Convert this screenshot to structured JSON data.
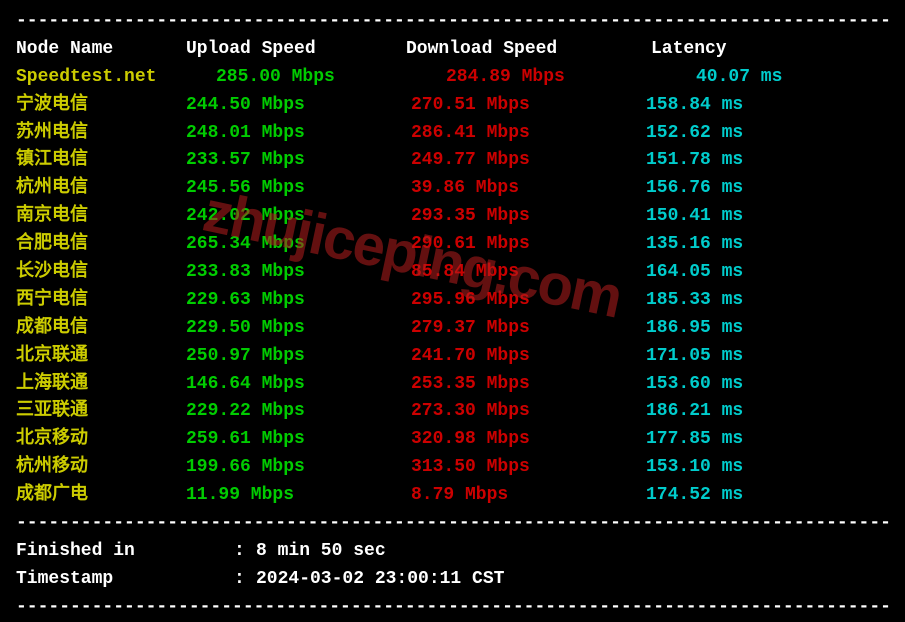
{
  "divider": "----------------------------------------------------------------------------------",
  "headers": {
    "node": "Node Name",
    "upload": "Upload Speed",
    "download": "Download Speed",
    "latency": "Latency"
  },
  "speedtest": {
    "name": "Speedtest.net",
    "upload": "285.00 Mbps",
    "download": "284.89 Mbps",
    "latency": "40.07 ms"
  },
  "rows": [
    {
      "node": "宁波电信",
      "upload": "244.50 Mbps",
      "download": "270.51 Mbps",
      "latency": "158.84 ms"
    },
    {
      "node": "苏州电信",
      "upload": "248.01 Mbps",
      "download": "286.41 Mbps",
      "latency": "152.62 ms"
    },
    {
      "node": "镇江电信",
      "upload": "233.57 Mbps",
      "download": "249.77 Mbps",
      "latency": "151.78 ms"
    },
    {
      "node": "杭州电信",
      "upload": "245.56 Mbps",
      "download": "39.86 Mbps",
      "latency": "156.76 ms"
    },
    {
      "node": "南京电信",
      "upload": "242.02 Mbps",
      "download": "293.35 Mbps",
      "latency": "150.41 ms"
    },
    {
      "node": "合肥电信",
      "upload": "265.34 Mbps",
      "download": "290.61 Mbps",
      "latency": "135.16 ms"
    },
    {
      "node": "长沙电信",
      "upload": "233.83 Mbps",
      "download": "85.84 Mbps",
      "latency": "164.05 ms"
    },
    {
      "node": "西宁电信",
      "upload": "229.63 Mbps",
      "download": "295.96 Mbps",
      "latency": "185.33 ms"
    },
    {
      "node": "成都电信",
      "upload": "229.50 Mbps",
      "download": "279.37 Mbps",
      "latency": "186.95 ms"
    },
    {
      "node": "北京联通",
      "upload": "250.97 Mbps",
      "download": "241.70 Mbps",
      "latency": "171.05 ms"
    },
    {
      "node": "上海联通",
      "upload": "146.64 Mbps",
      "download": "253.35 Mbps",
      "latency": "153.60 ms"
    },
    {
      "node": "三亚联通",
      "upload": "229.22 Mbps",
      "download": "273.30 Mbps",
      "latency": "186.21 ms"
    },
    {
      "node": "北京移动",
      "upload": "259.61 Mbps",
      "download": "320.98 Mbps",
      "latency": "177.85 ms"
    },
    {
      "node": "杭州移动",
      "upload": "199.66 Mbps",
      "download": "313.50 Mbps",
      "latency": "153.10 ms"
    },
    {
      "node": "成都广电",
      "upload": "11.99 Mbps",
      "download": "8.79 Mbps",
      "latency": "174.52 ms"
    }
  ],
  "footer": {
    "finished_label": "Finished in",
    "finished_value": "8 min 50 sec",
    "timestamp_label": "Timestamp",
    "timestamp_value": "2024-03-02 23:00:11 CST",
    "colon": ":"
  },
  "watermark": "zhujiceping.com"
}
